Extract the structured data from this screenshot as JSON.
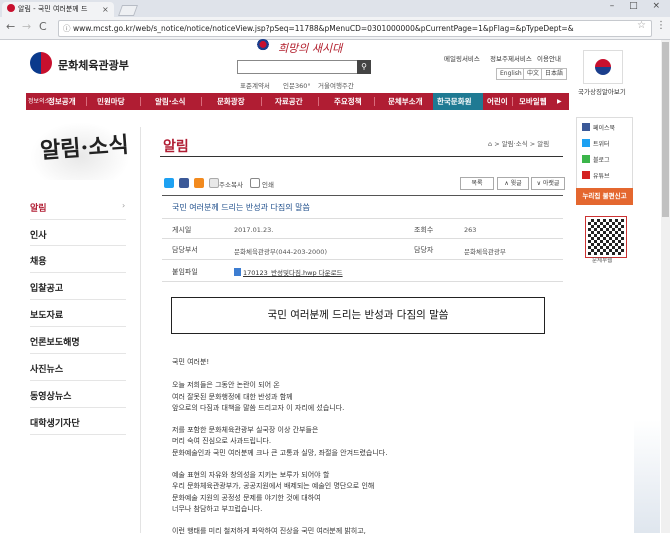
{
  "browser": {
    "tab_title": "알림 - 국민 여러분께 드",
    "tab_close": "×",
    "url": "www.mcst.go.kr/web/s_notice/notice/noticeView.jsp?pSeq=11788&pMenuCD=0301000000&pCurrentPage=1&pFlag=&pTypeDept=&",
    "back": "←",
    "forward": "→",
    "reload": "C",
    "window_controls": "– □ ×"
  },
  "header": {
    "ministry": "문화체육관광부",
    "slogan": "희망의 새시대",
    "search_placeholder": "",
    "links": [
      "표준계약서",
      "인문360°",
      "거울여행주간"
    ],
    "util": [
      "메일링서비스",
      "정보주제서비스",
      "이용안내"
    ],
    "langs": [
      "English",
      "中文",
      "日本語"
    ],
    "flag_caption": "국가상징알아보기"
  },
  "gnb": {
    "items": [
      "정보공개",
      "민원마당",
      "알림·소식",
      "문화광장",
      "자료공간",
      "주요정책",
      "문체부소개",
      "한국문화원",
      "어린이",
      "모바일웹"
    ],
    "prefix": "정보의소",
    "more": "▶"
  },
  "quick": {
    "items": [
      "페이스북",
      "트위터",
      "블로그",
      "유튜브"
    ],
    "partner": "누리집 불편신고",
    "qr_caption": "문체부웹"
  },
  "left_menu": {
    "title": "알림·소식",
    "items": [
      "알림",
      "인사",
      "채용",
      "입찰공고",
      "보도자료",
      "언론보도해명",
      "사진뉴스",
      "동영상뉴스",
      "대학생기자단"
    ],
    "arrow": "›"
  },
  "content": {
    "title": "알림",
    "breadcrumb": "⌂ > 알림·소식 > 알림",
    "share": {
      "copy": "주소복사",
      "print": "인쇄"
    },
    "buttons": [
      "목록",
      "∧ 윗글",
      "∨ 아랫글"
    ],
    "post_title": "국민 여러분께 드리는 반성과 다짐의 말씀",
    "meta": {
      "date_label": "게시일",
      "date": "2017.01.23.",
      "views_label": "조회수",
      "views": "263",
      "dept_label": "담당부서",
      "dept": "문화체육관광부(044-203-2000)",
      "owner_label": "담당자",
      "owner": "문화체육관광부",
      "file_label": "붙임파일",
      "file": "170123_반성및다짐.hwp 다운로드"
    },
    "boxed_title": "국민 여러분께 드리는 반성과 다짐의 말씀",
    "body": [
      "국민 여러분!",
      "오늘 저희들은 그동안 논란이 되어 온",
      "여러 잘못된 문화행정에 대한 반성과 함께",
      "앞으로의 다짐과 대책을 말씀 드리고자 이 자리에 섰습니다.",
      "저를 포함한 문화체육관광부 실국장 이상 간부들은",
      "머리 숙여 진심으로 사과드립니다.",
      "문화예술인과 국민 여러분께 크나 큰 고통과 실망, 좌절을 안겨드렸습니다.",
      "예술 표현의 자유와 창의성을 지키는 보루가 되어야 할",
      "우리 문화체육관광부가, 공공지원에서 배제되는 예술인 명단으로 인해",
      "문화예술 지원의 공정성 문제를 야기한 것에 대하여",
      "너무나 참담하고 부끄럽습니다.",
      "이런 행태를 미리 철저하게 파악하여 진상을 국민 여러분께 밝히고,"
    ]
  }
}
